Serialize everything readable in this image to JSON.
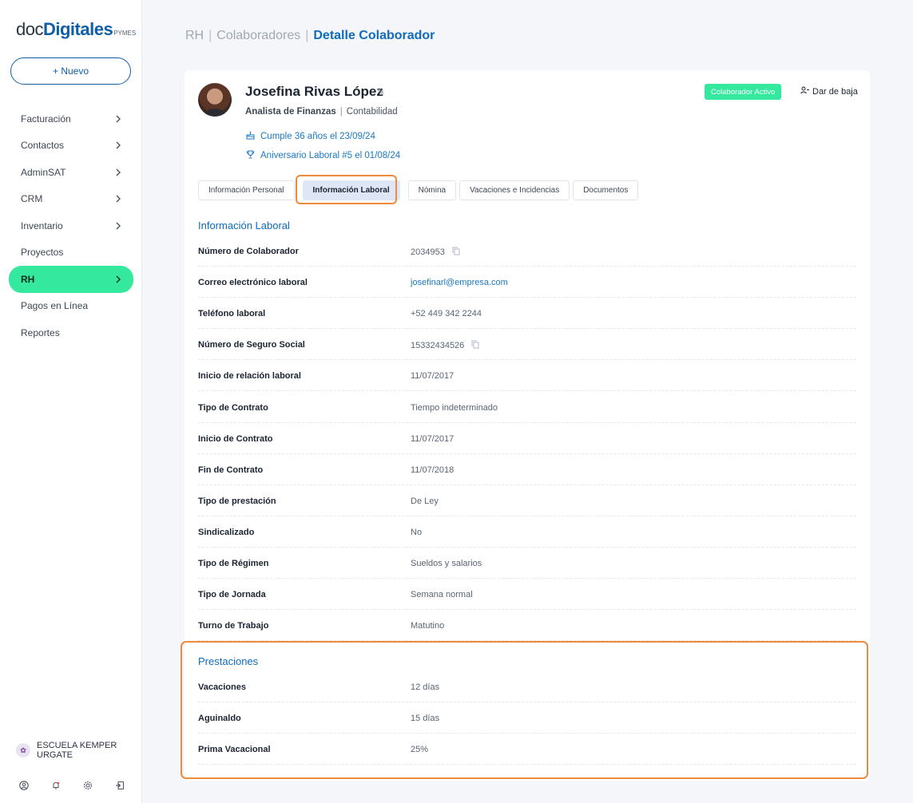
{
  "sidebar": {
    "logo": {
      "pre": "doc",
      "strong": "Digitales",
      "sub": "PYMES"
    },
    "new_button": "+ Nuevo",
    "items": [
      {
        "label": "Facturación",
        "chevron": true
      },
      {
        "label": "Contactos",
        "chevron": true
      },
      {
        "label": "AdminSAT",
        "chevron": true
      },
      {
        "label": "CRM",
        "chevron": true
      },
      {
        "label": "Inventario",
        "chevron": true
      },
      {
        "label": "Proyectos",
        "chevron": false
      },
      {
        "label": "RH",
        "chevron": true,
        "active": true
      },
      {
        "label": "Pagos en Línea",
        "chevron": false
      },
      {
        "label": "Reportes",
        "chevron": false
      }
    ],
    "company": {
      "name_line1": "ESCUELA KEMPER",
      "name_line2": "URGATE"
    },
    "bottom_icons": [
      "user-icon",
      "bell-icon",
      "gear-icon",
      "logout-icon"
    ]
  },
  "breadcrumb": {
    "item1": "RH",
    "item2": "Colaboradores",
    "current": "Detalle Colaborador"
  },
  "employee": {
    "name": "Josefina Rivas López",
    "role": "Analista de Finanzas",
    "department": "Contabilidad",
    "birthday": "Cumple 36 años el 23/09/24",
    "anniversary": "Aniversario Laboral #5 el 01/08/24",
    "status": "Colaborador Activo",
    "dar_baja": "Dar de baja"
  },
  "tabs": [
    {
      "label": "Información Personal"
    },
    {
      "label": "Información Laboral",
      "active": true
    },
    {
      "label": "Nómina"
    },
    {
      "label": "Vacaciones e Incidencias"
    },
    {
      "label": "Documentos"
    }
  ],
  "laboral": {
    "title": "Información Laboral",
    "rows": [
      {
        "label": "Número de Colaborador",
        "value": "2034953",
        "copy": true
      },
      {
        "label": "Correo electrónico laboral",
        "value": "josefinarl@empresa.com",
        "link": true
      },
      {
        "label": "Teléfono laboral",
        "value": "+52 449 342 2244"
      },
      {
        "label": "Número de Seguro Social",
        "value": "15332434526",
        "copy": true
      },
      {
        "label": "Inicio de relación laboral",
        "value": "11/07/2017"
      },
      {
        "label": "Tipo de Contrato",
        "value": "Tiempo indeterminado"
      },
      {
        "label": "Inicio de Contrato",
        "value": "11/07/2017"
      },
      {
        "label": "Fin de Contrato",
        "value": "11/07/2018"
      },
      {
        "label": "Tipo de prestación",
        "value": "De Ley"
      },
      {
        "label": "Sindicalizado",
        "value": "No"
      },
      {
        "label": "Tipo de Régimen",
        "value": "Sueldos y salarios"
      },
      {
        "label": "Tipo de Jornada",
        "value": "Semana normal"
      },
      {
        "label": "Turno de Trabajo",
        "value": "Matutino"
      }
    ]
  },
  "prestaciones": {
    "title": "Prestaciones",
    "rows": [
      {
        "label": "Vacaciones",
        "value": "12 días"
      },
      {
        "label": "Aguinaldo",
        "value": "15 días"
      },
      {
        "label": "Prima Vacacional",
        "value": "25%"
      }
    ]
  },
  "colors": {
    "accent": "#0f6cbd",
    "active_green": "#34e89e",
    "highlight_orange": "#ee8a3c"
  }
}
